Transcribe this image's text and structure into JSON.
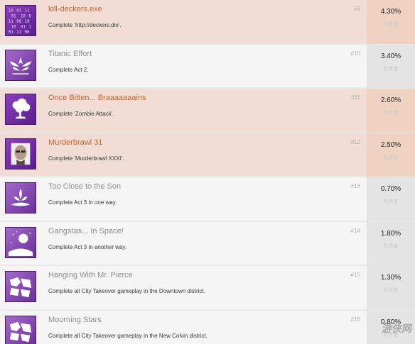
{
  "achievements": [
    {
      "title": "kill-deckers.exe",
      "desc": "Complete 'http://deckers.die'.",
      "rank": "#9",
      "percent": "4.30%",
      "rarity_label": "珍贵度",
      "unlocked": true,
      "icon": "matrix-code-icon"
    },
    {
      "title": "Titanic Effort",
      "desc": "Complete Act 2.",
      "rank": "#10",
      "percent": "3.40%",
      "rarity_label": "珍贵度",
      "unlocked": false,
      "icon": "winged-emblem-icon"
    },
    {
      "title": "Once Bitten... Braaaaaaains",
      "desc": "Complete 'Zombie Attack'.",
      "rank": "#11",
      "percent": "2.60%",
      "rarity_label": "珍贵度",
      "unlocked": true,
      "icon": "brain-tree-icon"
    },
    {
      "title": "Murderbrawl 31",
      "desc": "Complete 'Murderbrawl XXXI'.",
      "rank": "#12",
      "percent": "2.50%",
      "rarity_label": "珍贵度",
      "unlocked": true,
      "icon": "portrait-icon"
    },
    {
      "title": "Too Close to the Son",
      "desc": "Complete Act 3 in one way.",
      "rank": "#13",
      "percent": "0.70%",
      "rarity_label": "珍贵度",
      "unlocked": false,
      "icon": "fleur-emblem-icon"
    },
    {
      "title": "Gangstas... In Space!",
      "desc": "Complete Act 3 in another way.",
      "rank": "#14",
      "percent": "1.80%",
      "rarity_label": "珍贵度",
      "unlocked": false,
      "icon": "space-planet-icon"
    },
    {
      "title": "Hanging With Mr. Pierce",
      "desc": "Complete all City Takeover gameplay in the Downtown district.",
      "rank": "#15",
      "percent": "1.30%",
      "rarity_label": "珍贵度",
      "unlocked": false,
      "icon": "city-district-icon"
    },
    {
      "title": "Mourning Stars",
      "desc": "Complete all City Takeover gameplay in the New Colvin district.",
      "rank": "#16",
      "percent": "0.80%",
      "rarity_label": "珍贵度",
      "unlocked": false,
      "icon": "city-district-icon"
    }
  ],
  "watermark": "游侠网",
  "colors": {
    "unlocked_title": "#c8652d",
    "locked_title": "#8e8e8e",
    "icon_purple": "#6b2a9e"
  }
}
